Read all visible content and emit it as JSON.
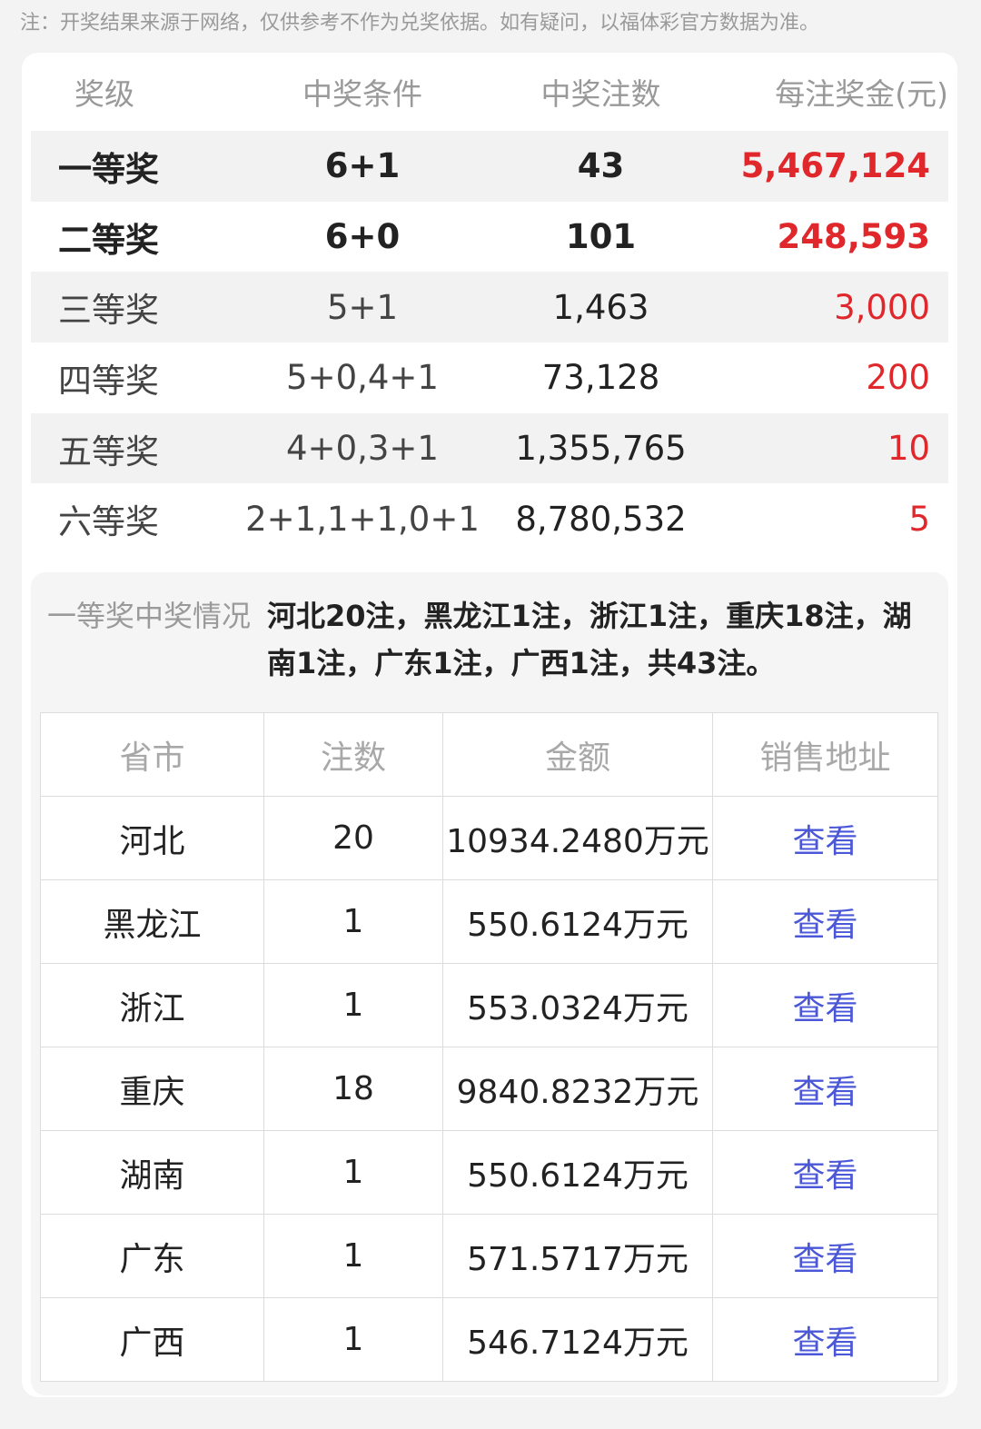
{
  "notice": "注：开奖结果来源于网络，仅供参考不作为兑奖依据。如有疑问，以福体彩官方数据为准。",
  "prize_table": {
    "headers": [
      "奖级",
      "中奖条件",
      "中奖注数",
      "每注奖金(元)"
    ],
    "rows": [
      {
        "level": "一等奖",
        "condition": "6+1",
        "count": "43",
        "amount": "5,467,124"
      },
      {
        "level": "二等奖",
        "condition": "6+0",
        "count": "101",
        "amount": "248,593"
      },
      {
        "level": "三等奖",
        "condition": "5+1",
        "count": "1,463",
        "amount": "3,000"
      },
      {
        "level": "四等奖",
        "condition": "5+0,4+1",
        "count": "73,128",
        "amount": "200"
      },
      {
        "level": "五等奖",
        "condition": "4+0,3+1",
        "count": "1,355,765",
        "amount": "10"
      },
      {
        "level": "六等奖",
        "condition": "2+1,1+1,0+1",
        "count": "8,780,532",
        "amount": "5"
      }
    ]
  },
  "first_prize": {
    "label": "一等奖中奖情况",
    "summary": "河北20注，黑龙江1注，浙江1注，重庆18注，湖南1注，广东1注，广西1注，共43注。"
  },
  "province_table": {
    "headers": [
      "省市",
      "注数",
      "金额",
      "销售地址"
    ],
    "rows": [
      {
        "province": "河北",
        "count": "20",
        "amount": "10934.2480万元",
        "link": "查看"
      },
      {
        "province": "黑龙江",
        "count": "1",
        "amount": "550.6124万元",
        "link": "查看"
      },
      {
        "province": "浙江",
        "count": "1",
        "amount": "553.0324万元",
        "link": "查看"
      },
      {
        "province": "重庆",
        "count": "18",
        "amount": "9840.8232万元",
        "link": "查看"
      },
      {
        "province": "湖南",
        "count": "1",
        "amount": "550.6124万元",
        "link": "查看"
      },
      {
        "province": "广东",
        "count": "1",
        "amount": "571.5717万元",
        "link": "查看"
      },
      {
        "province": "广西",
        "count": "1",
        "amount": "546.7124万元",
        "link": "查看"
      }
    ]
  }
}
